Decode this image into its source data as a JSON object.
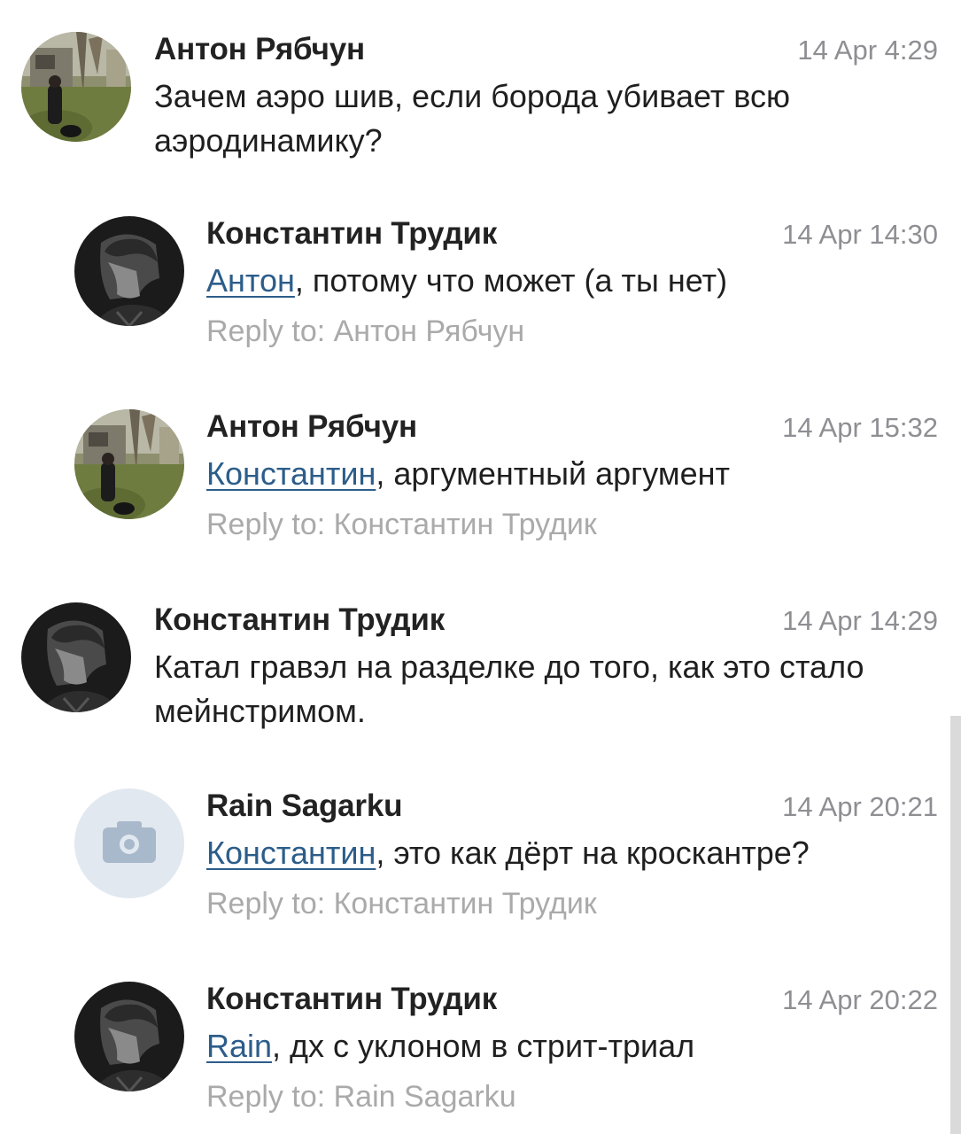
{
  "comments": [
    {
      "author": "Антон Рябчун",
      "time": "14 Apr 4:29",
      "text": "Зачем аэро шив, если борода убивает всю аэродинамику?",
      "avatar_icon": "photo-avatar-outdoor-icon"
    },
    {
      "author": "Константин Трудик",
      "time": "14 Apr 14:30",
      "mention": "Антон",
      "text": ", потому что может (а ты нет)",
      "reply_to": "Reply to: Антон Рябчун",
      "avatar_icon": "photo-avatar-portrait-icon"
    },
    {
      "author": "Антон Рябчун",
      "time": "14 Apr 15:32",
      "mention": "Константин",
      "text": ", аргументный аргумент",
      "reply_to": "Reply to: Константин Трудик",
      "avatar_icon": "photo-avatar-outdoor-icon"
    },
    {
      "author": "Константин Трудик",
      "time": "14 Apr 14:29",
      "text": "Катал гравэл на разделке до того, как это стало мейнстримом.",
      "avatar_icon": "photo-avatar-portrait-icon"
    },
    {
      "author": "Rain Sagarku",
      "time": "14 Apr 20:21",
      "mention": "Константин",
      "text": ", это как дёрт на кроскантре?",
      "reply_to": "Reply to: Константин Трудик",
      "avatar_icon": "camera-placeholder-icon"
    },
    {
      "author": "Константин Трудик",
      "time": "14 Apr 20:22",
      "mention": "Rain",
      "text": ", дх с уклоном в стрит-триал",
      "reply_to": "Reply to: Rain Sagarku",
      "avatar_icon": "photo-avatar-portrait-icon"
    }
  ],
  "colors": {
    "mention": "#2c5d8a",
    "timestamp": "#8e8e93",
    "reply_to": "#aaaaaa",
    "author": "#222222"
  }
}
